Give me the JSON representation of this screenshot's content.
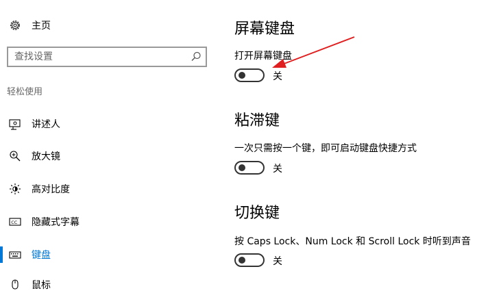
{
  "sidebar": {
    "home_label": "主页",
    "home_icon": "gear-icon",
    "search_placeholder": "查找设置",
    "search_icon": "search-icon",
    "group_label": "轻松使用",
    "items": [
      {
        "label": "讲述人",
        "icon": "narrator-icon"
      },
      {
        "label": "放大镜",
        "icon": "magnifier-icon"
      },
      {
        "label": "高对比度",
        "icon": "high-contrast-icon"
      },
      {
        "label": "隐藏式字幕",
        "icon": "closed-captions-icon"
      },
      {
        "label": "键盘",
        "icon": "keyboard-icon",
        "selected": true
      },
      {
        "label": "鼠标",
        "icon": "mouse-icon"
      }
    ],
    "accent_color": "#0078d7"
  },
  "sections": [
    {
      "title": "屏幕键盘",
      "description": "打开屏幕键盘",
      "toggle_state": "关",
      "on": false
    },
    {
      "title": "粘滞键",
      "description": "一次只需按一个键，即可启动键盘快捷方式",
      "toggle_state": "关",
      "on": false
    },
    {
      "title": "切换键",
      "description": "按 Caps Lock、Num Lock 和 Scroll Lock 时听到声音",
      "toggle_state": "关",
      "on": false
    }
  ],
  "annotation": {
    "color": "#e02020"
  }
}
